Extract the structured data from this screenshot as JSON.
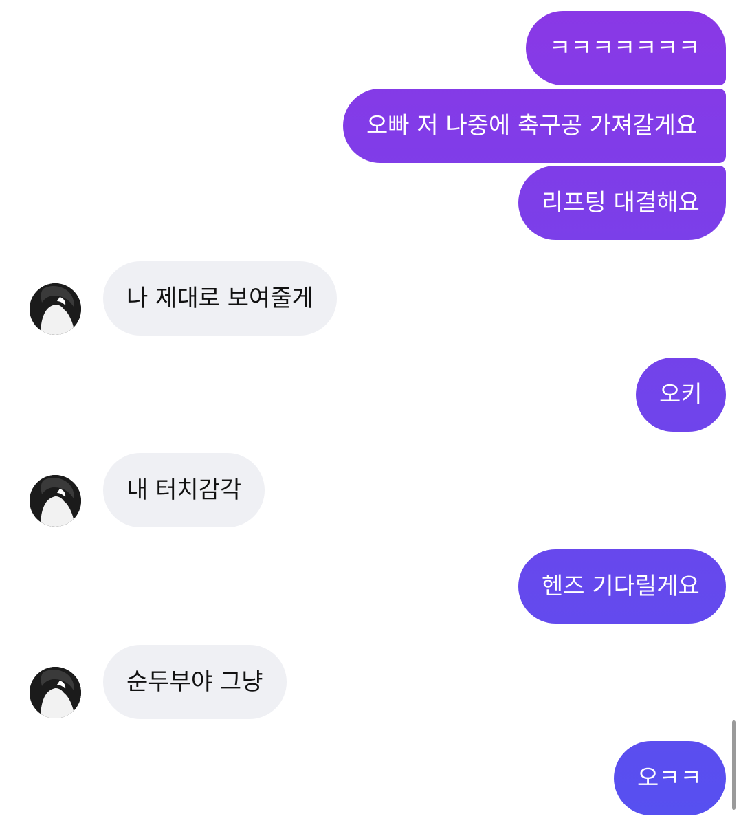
{
  "colors": {
    "outgoing_top": "#8a38e6",
    "outgoing_bottom": "#5650f0",
    "incoming_bg": "#eff0f4"
  },
  "icons": {
    "avatar": "profile-photo-avatar-icon"
  },
  "messages": [
    {
      "direction": "outgoing",
      "text": "ㅋㅋㅋㅋㅋㅋㅋ"
    },
    {
      "direction": "outgoing",
      "text": "오빠 저 나중에 축구공 가져갈게요"
    },
    {
      "direction": "outgoing",
      "text": "리프팅 대결해요"
    },
    {
      "direction": "incoming",
      "text": "나 제대로 보여줄게"
    },
    {
      "direction": "outgoing",
      "text": "오키"
    },
    {
      "direction": "incoming",
      "text": "내 터치감각"
    },
    {
      "direction": "outgoing",
      "text": "헨즈 기다릴게요"
    },
    {
      "direction": "incoming",
      "text": "순두부야 그냥"
    },
    {
      "direction": "outgoing",
      "text": "오ㅋㅋ"
    }
  ]
}
